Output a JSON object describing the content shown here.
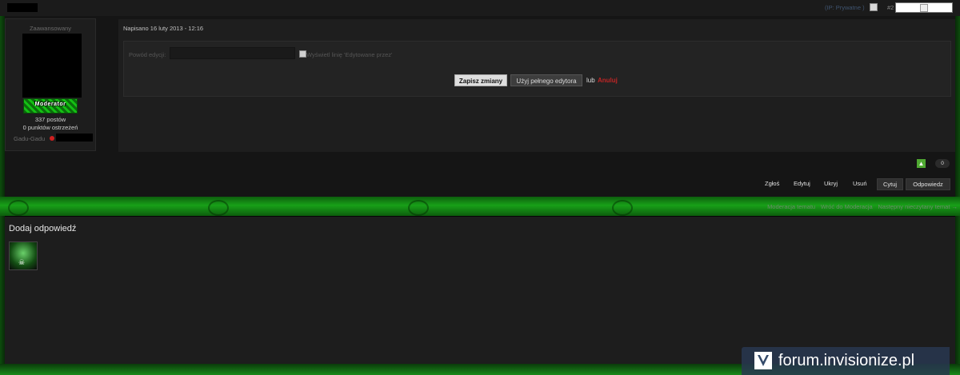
{
  "post": {
    "ip": "(IP: Prywatne )",
    "number": "#2",
    "date": "Napisano 16 luty 2013 - 12:16"
  },
  "author": {
    "rank": "Zaawansowany",
    "badge": "Moderator",
    "posts": "337 postów",
    "warnings": "0 punktów ostrzeżeń",
    "gg_label": "Gadu-Gadu"
  },
  "edit": {
    "reason_label": "Powód edycji:",
    "reason_value": "",
    "show_edited_label": "Wyświetl linię 'Edytowane przez'",
    "save_label": "Zapisz zmiany",
    "full_editor_label": "Użyj pełnego edytora",
    "or_label": "lub",
    "cancel_label": "Anuluj"
  },
  "reputation": {
    "plus_icon": "arrow-up-icon",
    "count": "0"
  },
  "actions": {
    "report": "Zgłoś",
    "edit": "Edytuj",
    "hide": "Ukryj",
    "delete": "Usuń",
    "quote": "Cytuj",
    "reply": "Odpowiedz"
  },
  "topic_links": {
    "moderate": "Moderacja tematu",
    "back": "Wróć do Moderacja",
    "next": "Następny nieczytany temat →"
  },
  "reply": {
    "title": "Dodaj odpowiedź"
  },
  "watermark": {
    "text": "forum.invisionize.pl"
  },
  "colors": {
    "accent_green": "#18a018",
    "cancel_red": "#c02525",
    "rep_green": "#4fa832"
  }
}
